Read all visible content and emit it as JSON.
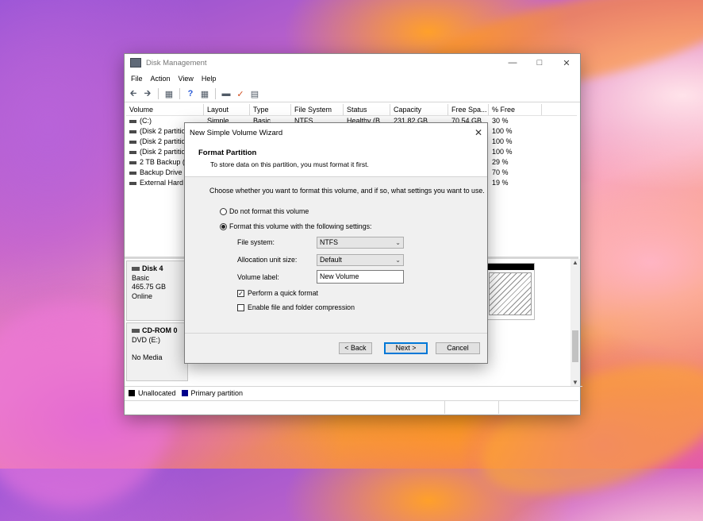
{
  "disk_mgmt": {
    "title": "Disk Management",
    "menu": [
      "File",
      "Action",
      "View",
      "Help"
    ],
    "columns": [
      "Volume",
      "Layout",
      "Type",
      "File System",
      "Status",
      "Capacity",
      "Free Spa...",
      "% Free"
    ],
    "rows": [
      {
        "volume": "(C:)",
        "layout": "Simple",
        "type": "Basic",
        "fs": "NTFS",
        "status": "Healthy (B...",
        "capacity": "231.82 GB",
        "free": "70.54 GB",
        "pct": "30 %"
      },
      {
        "volume": "(Disk 2 partition",
        "layout": "",
        "type": "",
        "fs": "",
        "status": "",
        "capacity": "",
        "free": "",
        "pct": "100 %"
      },
      {
        "volume": "(Disk 2 partition",
        "layout": "",
        "type": "",
        "fs": "",
        "status": "",
        "capacity": "",
        "free": "",
        "pct": "100 %"
      },
      {
        "volume": "(Disk 2 partition",
        "layout": "",
        "type": "",
        "fs": "",
        "status": "",
        "capacity": "",
        "free": "",
        "pct": "100 %"
      },
      {
        "volume": "2 TB Backup (F",
        "layout": "",
        "type": "",
        "fs": "",
        "status": "",
        "capacity": "",
        "free": "",
        "pct": "29 %"
      },
      {
        "volume": "Backup Drive (",
        "layout": "",
        "type": "",
        "fs": "",
        "status": "",
        "capacity": "",
        "free": "",
        "pct": "70 %"
      },
      {
        "volume": "External Hard D",
        "layout": "",
        "type": "",
        "fs": "",
        "status": "",
        "capacity": "",
        "free": "",
        "pct": "19 %"
      }
    ],
    "disk4": {
      "name": "Disk 4",
      "type": "Basic",
      "size": "465.75 GB",
      "status": "Online"
    },
    "cdrom": {
      "name": "CD-ROM 0",
      "drive": "DVD (E:)",
      "media": "No Media"
    },
    "legend": {
      "unallocated": "Unallocated",
      "primary": "Primary partition",
      "unallocated_color": "#000000",
      "primary_color": "#00008b"
    }
  },
  "wizard": {
    "title": "New Simple Volume Wizard",
    "heading": "Format Partition",
    "subheading": "To store data on this partition, you must format it first.",
    "intro": "Choose whether you want to format this volume, and if so, what settings you want to use.",
    "opt_no_format": "Do not format this volume",
    "opt_format": "Format this volume with the following settings:",
    "fs_label": "File system:",
    "fs_value": "NTFS",
    "alloc_label": "Allocation unit size:",
    "alloc_value": "Default",
    "vol_label": "Volume label:",
    "vol_value": "New Volume",
    "quick_format": "Perform a quick format",
    "quick_format_checked": true,
    "compression": "Enable file and folder compression",
    "back": "< Back",
    "next": "Next >",
    "cancel": "Cancel"
  }
}
